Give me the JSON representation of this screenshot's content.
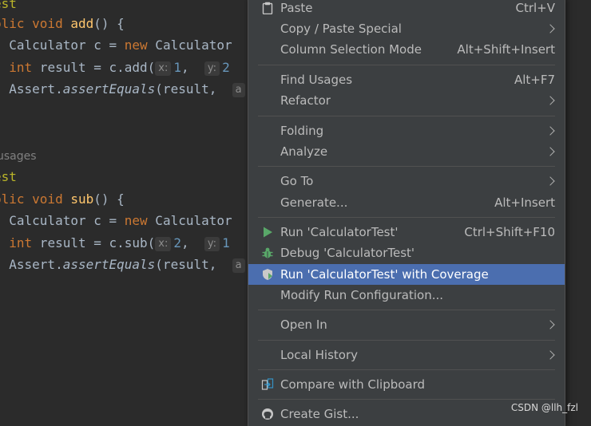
{
  "editor": {
    "usages_hint": "usages",
    "line1": "est",
    "line2_kw": "blic void ",
    "line2_fn": "add",
    "line2_rest": "() {",
    "line3_a": "  Calculator c = ",
    "line3_kw": "new",
    "line3_b": " Calculator",
    "line4_kw": "  int",
    "line4_a": " result = c.add(",
    "line4_hint1": "x:",
    "line4_num1": "1",
    "line4_comma": ",  ",
    "line4_hint2": "y:",
    "line4_num2": "2",
    "line5_a": "  Assert.",
    "line5_it": "assertEquals",
    "line5_b": "(result,  ",
    "line5_hint": "a",
    "line7": "est",
    "line8_kw": "blic void ",
    "line8_fn": "sub",
    "line8_rest": "() {",
    "line9_a": "  Calculator c = ",
    "line9_kw": "new",
    "line9_b": " Calculator",
    "line10_kw": "  int",
    "line10_a": " result = c.sub(",
    "line10_hint1": "x:",
    "line10_num1": "2",
    "line10_comma": ",  ",
    "line10_hint2": "y:",
    "line10_num2": "1",
    "line11_a": "  Assert.",
    "line11_it": "assertEquals",
    "line11_b": "(result,  ",
    "line11_hint": "a"
  },
  "menu": {
    "paste": {
      "label": "Paste",
      "shortcut": "Ctrl+V"
    },
    "copy_paste_special": {
      "label": "Copy / Paste Special"
    },
    "column_selection": {
      "label": "Column Selection Mode",
      "shortcut": "Alt+Shift+Insert"
    },
    "find_usages": {
      "label": "Find Usages",
      "shortcut": "Alt+F7"
    },
    "refactor": {
      "label": "Refactor"
    },
    "folding": {
      "label": "Folding"
    },
    "analyze": {
      "label": "Analyze"
    },
    "go_to": {
      "label": "Go To"
    },
    "generate": {
      "label": "Generate...",
      "shortcut": "Alt+Insert"
    },
    "run": {
      "label": "Run 'CalculatorTest'",
      "shortcut": "Ctrl+Shift+F10"
    },
    "debug": {
      "label": "Debug 'CalculatorTest'"
    },
    "run_coverage": {
      "label": "Run 'CalculatorTest' with Coverage"
    },
    "modify_run": {
      "label": "Modify Run Configuration..."
    },
    "open_in": {
      "label": "Open In"
    },
    "local_history": {
      "label": "Local History"
    },
    "compare_clipboard": {
      "label": "Compare with Clipboard"
    },
    "create_gist": {
      "label": "Create Gist..."
    }
  },
  "watermark": "CSDN @llh_fzl",
  "colors": {
    "editor_bg": "#2b2b2b",
    "menu_bg": "#3c3f41",
    "selection": "#4b6eaf",
    "keyword": "#cc7832",
    "function": "#ffc66d",
    "annotation": "#bbb529",
    "number": "#6897bb"
  }
}
